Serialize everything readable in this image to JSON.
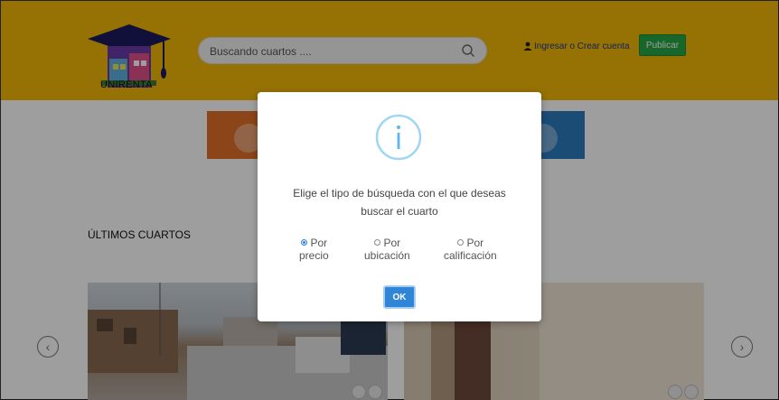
{
  "header": {
    "brand": "UNIRENTA",
    "search": {
      "placeholder": "Buscando cuartos ...."
    },
    "login_label": "Ingresar o Crear cuenta",
    "publish_label": "Publicar"
  },
  "main": {
    "section_title": "ÚLTIMOS CUARTOS"
  },
  "modal": {
    "icon": "info-icon",
    "line1": "Elige el tipo de búsqueda con el que deseas",
    "line2": "buscar el cuarto",
    "options": [
      {
        "line1": "Por",
        "line2": "precio",
        "selected": true
      },
      {
        "line1": "Por",
        "line2": "ubicación",
        "selected": false
      },
      {
        "line1": "Por",
        "line2": "calificación",
        "selected": false
      }
    ],
    "ok_label": "OK"
  },
  "colors": {
    "header": "#f2b705",
    "publish": "#28a745",
    "accent": "#3085d6",
    "info_ring": "#87cefa"
  }
}
